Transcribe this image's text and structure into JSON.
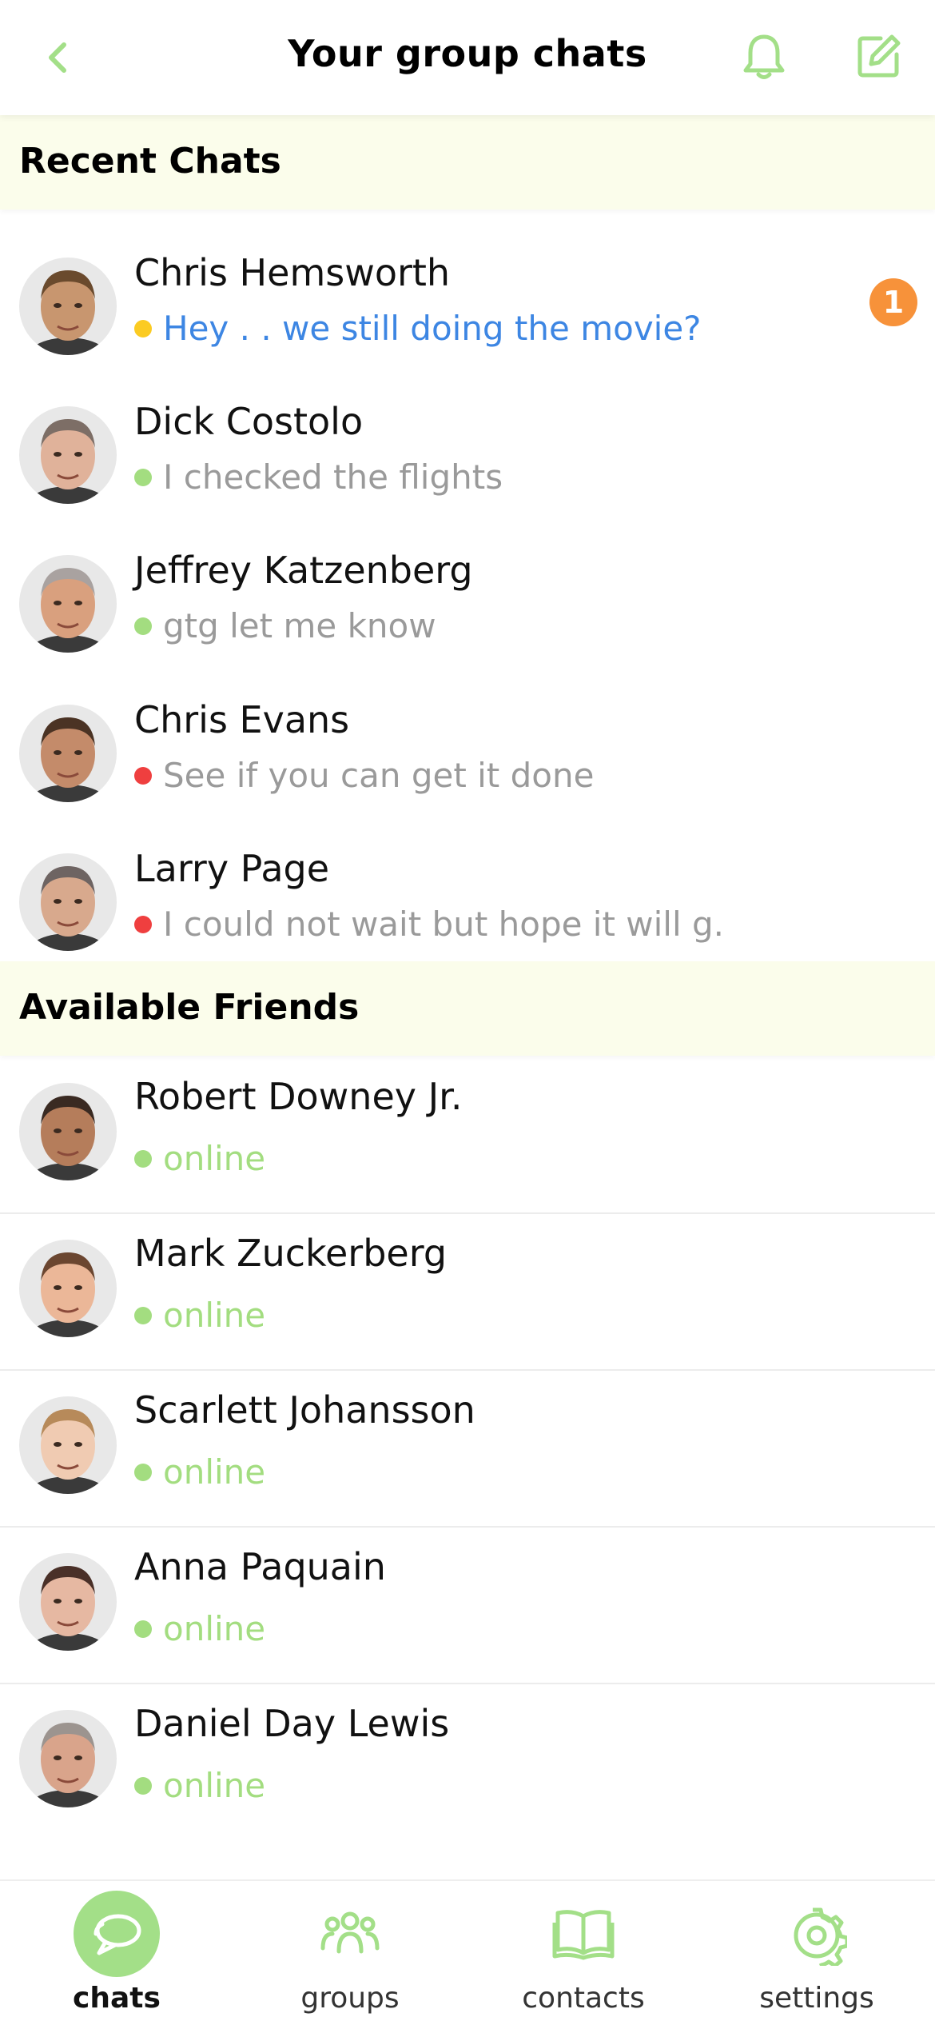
{
  "header": {
    "title": "Your group chats",
    "icons": {
      "back": "chevron-left-icon",
      "bell": "bell-icon",
      "compose": "compose-icon"
    }
  },
  "sections": {
    "recent": "Recent Chats",
    "friends": "Available Friends"
  },
  "recent_chats": [
    {
      "name": "Chris Hemsworth",
      "message": "Hey . . we still doing the movie?",
      "status_color": "#fbcb22",
      "unread": "1",
      "highlight": true,
      "skin": "#c8966f",
      "hair": "#6a4a2d"
    },
    {
      "name": "Dick Costolo",
      "message": "I checked the flights",
      "status_color": "#a3dd80",
      "unread": "",
      "highlight": false,
      "skin": "#e0b29a",
      "hair": "#7d6e66"
    },
    {
      "name": "Jeffrey Katzenberg",
      "message": "gtg let me know",
      "status_color": "#a3dd80",
      "unread": "",
      "highlight": false,
      "skin": "#d9a07e",
      "hair": "#a9a2a0"
    },
    {
      "name": "Chris Evans",
      "message": "See if you can get it done",
      "status_color": "#ef3f3f",
      "unread": "",
      "highlight": false,
      "skin": "#c48b6a",
      "hair": "#4b3324"
    },
    {
      "name": "Larry Page",
      "message": "I could not wait but hope it will g.",
      "status_color": "#ef3f3f",
      "unread": "",
      "highlight": false,
      "skin": "#d8a98d",
      "hair": "#6e6462"
    }
  ],
  "friends": [
    {
      "name": "Robert Downey Jr.",
      "status": "online",
      "status_color": "#a3dd80",
      "skin": "#b57d5b",
      "hair": "#3a2a22"
    },
    {
      "name": "Mark Zuckerberg",
      "status": "online",
      "status_color": "#a3dd80",
      "skin": "#ebb798",
      "hair": "#6b4630"
    },
    {
      "name": "Scarlett Johansson",
      "status": "online",
      "status_color": "#a3dd80",
      "skin": "#f0cbb2",
      "hair": "#b78a5a"
    },
    {
      "name": "Anna Paquain",
      "status": "online",
      "status_color": "#a3dd80",
      "skin": "#e6b8a2",
      "hair": "#4a3028"
    },
    {
      "name": "Daniel Day Lewis",
      "status": "online",
      "status_color": "#a3dd80",
      "skin": "#d9a48b",
      "hair": "#9c948f"
    }
  ],
  "bottom_nav": [
    {
      "label": "chats",
      "icon": "chat-bubbles-icon",
      "active": true
    },
    {
      "label": "groups",
      "icon": "group-people-icon",
      "active": false
    },
    {
      "label": "contacts",
      "icon": "open-book-icon",
      "active": false
    },
    {
      "label": "settings",
      "icon": "gear-icon",
      "active": false
    }
  ],
  "colors": {
    "accent_green": "#a3df88",
    "section_bg": "#fbfdeb",
    "badge_orange": "#f7923a",
    "highlight_blue": "#3d86e3"
  }
}
